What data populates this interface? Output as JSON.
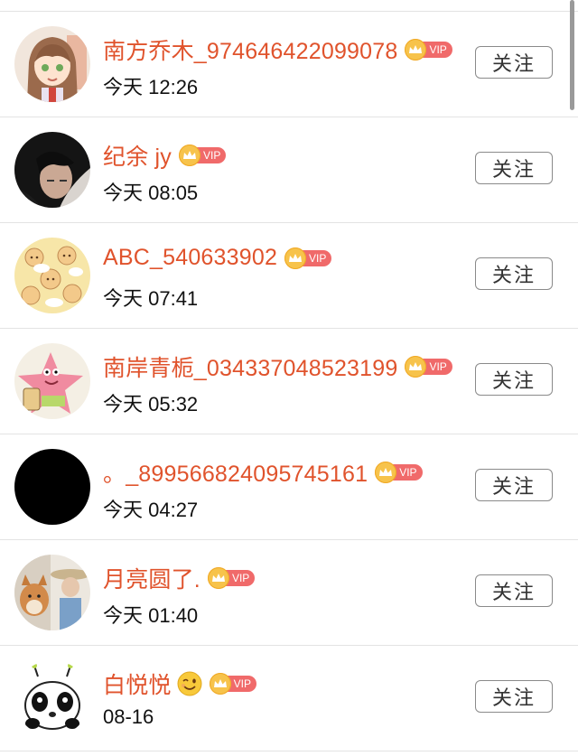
{
  "follow_label": "关注",
  "vip_label": "VIP",
  "users": [
    {
      "name": "南方乔木_974646422099078",
      "time": "今天 12:26",
      "vip": true,
      "avatar_icon": "anime-girl-avatar-icon"
    },
    {
      "name": "纪余 jy",
      "time": "今天 08:05",
      "vip": true,
      "avatar_icon": "girl-photo-avatar-icon"
    },
    {
      "name": "ABC_540633902",
      "time": "今天 07:41",
      "vip": true,
      "avatar_icon": "cartoon-pattern-avatar-icon"
    },
    {
      "name": "南岸青栀_034337048523199",
      "time": "今天 05:32",
      "vip": true,
      "avatar_icon": "patrick-star-avatar-icon"
    },
    {
      "name": "。_899566824095745161",
      "time": "今天 04:27",
      "vip": true,
      "avatar_icon": "black-avatar-icon"
    },
    {
      "name": "月亮圆了.",
      "time": "今天 01:40",
      "vip": true,
      "avatar_icon": "dog-photo-avatar-icon"
    },
    {
      "name": "白悦悦",
      "time": "08-16",
      "vip": true,
      "emoji": "wink-emoji-icon",
      "avatar_icon": "panda-cartoon-avatar-icon"
    }
  ],
  "colors": {
    "name": "#e0532c",
    "vip_badge": "#f06a6a",
    "crown": "#f7c34b",
    "divider": "#e3e3e3"
  }
}
